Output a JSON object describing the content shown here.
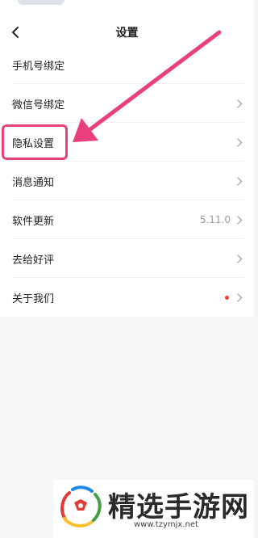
{
  "header": {
    "title": "设置"
  },
  "settings": {
    "items": [
      {
        "label": "手机号绑定",
        "chevron": false
      },
      {
        "label": "微信号绑定",
        "chevron": true
      },
      {
        "label": "隐私设置",
        "chevron": true
      },
      {
        "label": "消息通知",
        "chevron": true
      },
      {
        "label": "软件更新",
        "value": "5.11.0",
        "chevron": true
      },
      {
        "label": "去给好评",
        "chevron": true
      },
      {
        "label": "关于我们",
        "badge_dot": true,
        "chevron": true
      }
    ]
  },
  "annotation": {
    "color": "#ea3f7d",
    "highlighted_item": "隐私设置"
  },
  "watermark": {
    "title": "精选手游网",
    "url": "www.tzymjx.net"
  },
  "colors": {
    "background": "#f5f6f8",
    "panel": "#ffffff",
    "dot": "#ff3b30"
  },
  "icons": {
    "back": "chevron-left-icon",
    "row_arrow": "chevron-right-icon"
  }
}
